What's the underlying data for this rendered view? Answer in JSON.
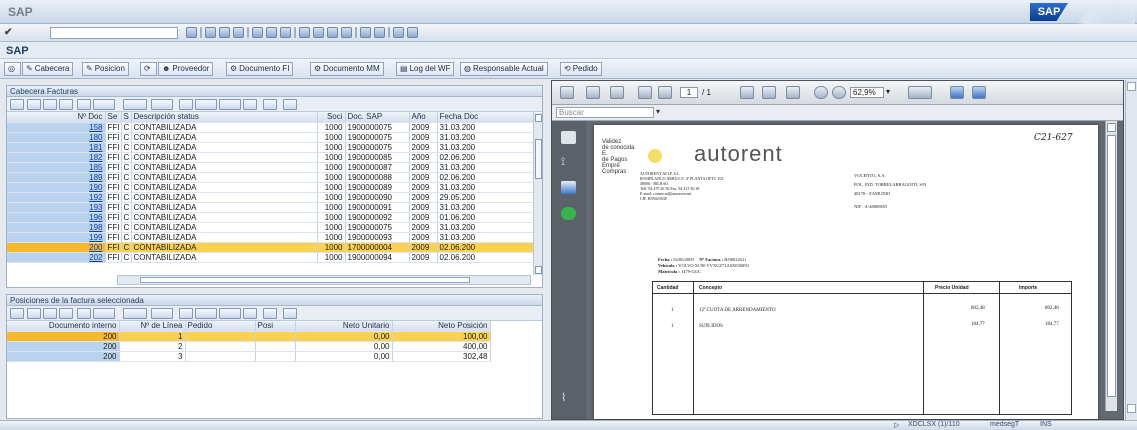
{
  "window": {
    "title": "SAP",
    "logo": "SAP"
  },
  "app_title": "SAP",
  "toolbar": {
    "buttons": [
      {
        "icon": "glasses-icon",
        "label": ""
      },
      {
        "icon": "pencil-icon",
        "label": "Cabecera"
      },
      {
        "icon": "pencil-icon",
        "label": "Posicion"
      },
      {
        "icon": "refresh-icon",
        "label": ""
      },
      {
        "icon": "person-icon",
        "label": "Proveedor"
      },
      {
        "icon": "document-icon",
        "label": "Documento FI"
      },
      {
        "icon": "document-icon",
        "label": "Documento MM"
      },
      {
        "icon": "log-icon",
        "label": "Log del WF"
      },
      {
        "icon": "users-icon",
        "label": "Responsable Actual"
      },
      {
        "icon": "order-icon",
        "label": "Pedido"
      }
    ]
  },
  "header_panel": {
    "caption": "Cabecera Facturas",
    "columns": [
      "Nº Doc",
      "Se",
      "S",
      "Descripción status",
      "Soci",
      "Doc. SAP",
      "Año",
      "Fecha Doc"
    ],
    "rows": [
      [
        "158",
        "FFI",
        "C",
        "CONTABILIZADA",
        "1000",
        "1900000075",
        "2009",
        "31.03.200"
      ],
      [
        "180",
        "FFI",
        "C",
        "CONTABILIZADA",
        "1000",
        "1900000075",
        "2009",
        "31.03.200"
      ],
      [
        "181",
        "FFI",
        "C",
        "CONTABILIZADA",
        "1000",
        "1900000075",
        "2009",
        "31.03.200"
      ],
      [
        "182",
        "FFI",
        "C",
        "CONTABILIZADA",
        "1000",
        "1900000085",
        "2009",
        "02.06.200"
      ],
      [
        "185",
        "FFI",
        "C",
        "CONTABILIZADA",
        "1000",
        "1900000087",
        "2009",
        "31.03.200"
      ],
      [
        "189",
        "FFI",
        "C",
        "CONTABILIZADA",
        "1000",
        "1900000088",
        "2009",
        "02.06.200"
      ],
      [
        "190",
        "FFI",
        "C",
        "CONTABILIZADA",
        "1000",
        "1900000089",
        "2009",
        "31.03.200"
      ],
      [
        "192",
        "FFI",
        "C",
        "CONTABILIZADA",
        "1000",
        "1900000090",
        "2009",
        "29.05.200"
      ],
      [
        "193",
        "FFI",
        "C",
        "CONTABILIZADA",
        "1000",
        "1900000091",
        "2009",
        "31.03.200"
      ],
      [
        "196",
        "FFI",
        "C",
        "CONTABILIZADA",
        "1000",
        "1900000092",
        "2009",
        "01.06.200"
      ],
      [
        "198",
        "FFI",
        "C",
        "CONTABILIZADA",
        "1000",
        "1900000075",
        "2009",
        "31.03.200"
      ],
      [
        "199",
        "FFI",
        "C",
        "CONTABILIZADA",
        "1000",
        "1900000093",
        "2009",
        "31.03.200"
      ],
      [
        "200",
        "FFI",
        "C",
        "CONTABILIZADA",
        "1000",
        "1700000004",
        "2009",
        "02.06.200"
      ],
      [
        "202",
        "FFI",
        "C",
        "CONTABILIZADA",
        "1000",
        "1900000094",
        "2009",
        "02.06.200"
      ]
    ],
    "selected_row": 12
  },
  "items_panel": {
    "caption": "Posiciones de la factura seleccionada",
    "columns": [
      "Documento interno",
      "Nº de Línea",
      "Pedido",
      "Posi",
      "Neto Unitario",
      "Neto Posición"
    ],
    "rows": [
      [
        "200",
        "1",
        "",
        "",
        "0,00",
        "100,00"
      ],
      [
        "200",
        "2",
        "",
        "",
        "0,00",
        "400,00"
      ],
      [
        "200",
        "3",
        "",
        "",
        "0,00",
        "302,48"
      ]
    ],
    "selected_row": 0
  },
  "pdf": {
    "page_field": "1",
    "page_total": "/ 1",
    "zoom": "62,9%",
    "search_placeholder": "Buscar",
    "doc": {
      "handwritten_ref": "C21-627",
      "stamp_text": "Validez\nde conocida\nE.\nde Pagos\nEmpre\nCompras",
      "logo_text": "autorent",
      "sender_lines": [
        "AUTORENT AVLP, S.L.",
        "ROSIBLANCO ARBUS 4ª, 4ª PLANTA  OFTC 102",
        "48006 - BILBAO",
        "Telf. 94 479 26 50  Fax. 94 413 36 38",
        "E-mail: comercial@autorent.net",
        "CIF. B95025638"
      ],
      "recipient_lines": [
        "VOCENTO, S.A.",
        "POL. IND. TORRELARRAGOITI, S/N",
        "48170 - ZAMUDIO",
        "",
        "NIF : A-48069655"
      ],
      "fecha_label": "Fecha :",
      "fecha_value": "02/06/2009",
      "factura_label": "Nº Factura :",
      "factura_value": "B/00024521",
      "vehiculo_label": "Vehículo :",
      "vehiculo_value": "VOLVO XC90 VVXCZ71A0X036850",
      "matricula_label": "Matrícula :",
      "matricula_value": "1479-GGC",
      "table_headers": [
        "Cantidad",
        "Concepto",
        "Precio Unidad",
        "Importe"
      ],
      "table_rows": [
        [
          "1",
          "12ª CUOTA DE ARRENDAMIENTO",
          "802,48",
          "802,48"
        ],
        [
          "1",
          "SUPLIDOS",
          "184,77",
          "184,77"
        ]
      ]
    }
  },
  "statusbar": {
    "segments": [
      "▷",
      "XDCLSX  (1)/110",
      "medsegT",
      "INS"
    ]
  }
}
